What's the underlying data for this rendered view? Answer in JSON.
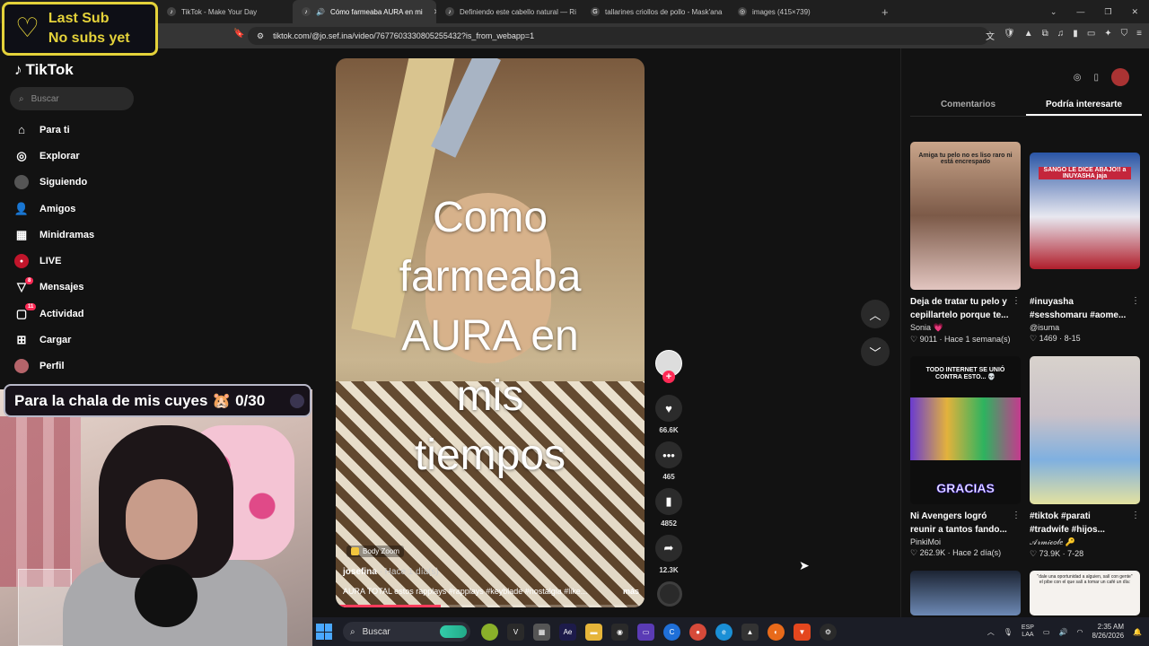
{
  "browser": {
    "tabs": [
      {
        "title": "TikTok - Make Your Day",
        "active": false
      },
      {
        "title": "Cómo farmeaba AURA en mi",
        "active": true
      },
      {
        "title": "Definiendo este cabello natural — Ri",
        "active": false
      },
      {
        "title": "tallarines criollos de pollo - Mask'ana",
        "active": false
      },
      {
        "title": "images (415×739)",
        "active": false
      }
    ],
    "url": "tiktok.com/@jo.sef.ina/video/7677603330805255432?is_from_webapp=1"
  },
  "overlay": {
    "last_sub_line1": "Last Sub",
    "last_sub_line2": "No subs yet",
    "goal_text": "Para la chala de mis cuyes 🐹 0/30"
  },
  "sidebar": {
    "logo": "TikTok",
    "search_placeholder": "Buscar",
    "items": [
      {
        "label": "Para ti",
        "icon": "home-icon"
      },
      {
        "label": "Explorar",
        "icon": "compass-icon"
      },
      {
        "label": "Siguiendo",
        "icon": "following-avatar-icon"
      },
      {
        "label": "Amigos",
        "icon": "friends-icon"
      },
      {
        "label": "Minidramas",
        "icon": "film-icon"
      },
      {
        "label": "LIVE",
        "icon": "live-icon"
      },
      {
        "label": "Mensajes",
        "icon": "messages-icon",
        "badge": "8"
      },
      {
        "label": "Actividad",
        "icon": "activity-icon",
        "badge": "11"
      },
      {
        "label": "Cargar",
        "icon": "upload-icon"
      },
      {
        "label": "Perfil",
        "icon": "profile-icon"
      }
    ]
  },
  "video": {
    "overlay_text": [
      "Como",
      "farmeaba",
      "AURA en",
      "mis",
      "tiempos"
    ],
    "effect": "Body Zoom",
    "author": "josefina",
    "posted": "· Hace 1 día(s)",
    "caption": "AURA TOTAL estos rapplays #rapplays #keyblade #nostalgia #like...",
    "more": "más",
    "progress": 0.34,
    "likes": "66.6K",
    "comments": "465",
    "saves": "4852",
    "shares": "12.3K"
  },
  "panel": {
    "tabs": [
      "Comentarios",
      "Podría interesarte"
    ],
    "active_tab": 1,
    "cards": [
      {
        "thumb_text": "Amiga tu pelo no es liso raro ni está encrespado",
        "title": "Deja de tratar tu pelo y cepillartelo porque te...",
        "user": "Sonia 💗",
        "views": "9011",
        "when": "Hace 1 semana(s)"
      },
      {
        "thumb_text": "SANGO LE DICE ABAJO!! a INUYASHA jaja",
        "title": "#inuyasha #sesshomaru #aome...",
        "user": "@isuma",
        "views": "1469",
        "when": "8-15"
      },
      {
        "thumb_text": "TODO INTERNET SE UNIÓ CONTRA ESTO... 💀",
        "thumb_footer": "GRACIAS",
        "title": "Ni Avengers logró reunir a tantos fando...",
        "user": "PinkiMoi",
        "views": "262.9K",
        "when": "Hace 2 día(s)"
      },
      {
        "thumb_text": "",
        "title": "#tiktok #parati #tradwife #hijos...",
        "user": "𝒜𝓇𝓂𝒾𝒸𝑜𝓁𝑒 🔑",
        "views": "73.9K",
        "when": "7-28"
      },
      {
        "thumb_text": "",
        "title": "",
        "user": "",
        "views": "",
        "when": ""
      },
      {
        "thumb_text": "\"dale una oportunidad a alguien, salí con gente\" el pibe con el que salí a tomar un café un día:",
        "title": "",
        "user": "",
        "views": "",
        "when": ""
      }
    ]
  },
  "taskbar": {
    "search_placeholder": "Buscar",
    "lang_line1": "ESP",
    "lang_line2": "LAA",
    "time": "2:35 AM",
    "date": "8/26/2026"
  },
  "colors": {
    "accent": "#ff2a55",
    "goal_border": "#b8b8c8",
    "lastsub": "#e4d23a"
  }
}
